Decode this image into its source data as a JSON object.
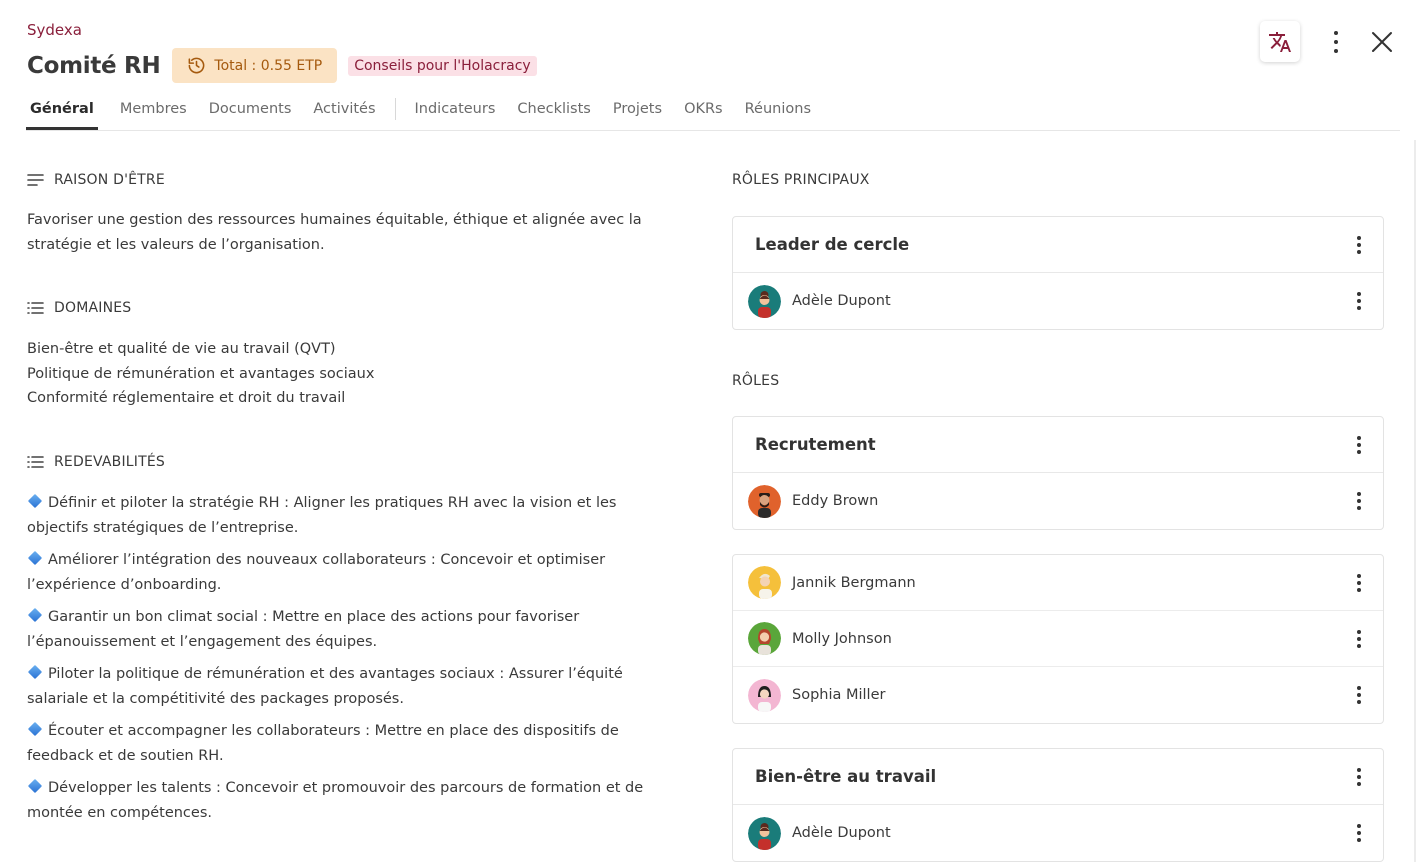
{
  "org_name": "Sydexa",
  "title": "Comité RH",
  "etp_badge": "Total : 0.55 ETP",
  "link_badge": "Conseils pour l'Holacracy",
  "colors": {
    "accent": "#8a1f3b",
    "etp_bg": "#fbe3c4",
    "etp_text": "#a55a0e",
    "link_bg": "#fbe0e6"
  },
  "icons": {
    "translate": "translate-icon",
    "more": "more-vert-icon",
    "close": "close-icon",
    "history": "history-icon"
  },
  "tabs": [
    {
      "label": "Général",
      "active": true
    },
    {
      "label": "Membres"
    },
    {
      "label": "Documents"
    },
    {
      "label": "Activités"
    },
    {
      "label": "Indicateurs"
    },
    {
      "label": "Checklists"
    },
    {
      "label": "Projets"
    },
    {
      "label": "OKRs"
    },
    {
      "label": "Réunions"
    }
  ],
  "purpose": {
    "heading": "RAISON D'ÊTRE",
    "text": "Favoriser une gestion des ressources humaines équitable, éthique et alignée avec la stratégie et les valeurs de l’organisation."
  },
  "domains": {
    "heading": "DOMAINES",
    "items": [
      "Bien-être et qualité de vie au travail (QVT)",
      "Politique de rémunération et avantages sociaux",
      "Conformité réglementaire et droit du travail"
    ]
  },
  "accountabilities": {
    "heading": "REDEVABILITÉS",
    "items": [
      "Définir et piloter la stratégie RH : Aligner les pratiques RH avec la vision et les objectifs stratégiques de l’entreprise.",
      "Améliorer l’intégration des nouveaux collaborateurs : Concevoir et optimiser l’expérience d’onboarding.",
      "Garantir un bon climat social : Mettre en place des actions pour favoriser l’épanouissement et l’engagement des équipes.",
      "Piloter la politique de rémunération et des avantages sociaux : Assurer l’équité salariale et la compétitivité des packages proposés.",
      "Écouter et accompagner les collaborateurs : Mettre en place des dispositifs de feedback et de soutien RH.",
      "Développer les talents : Concevoir et promouvoir des parcours de formation et de montée en compétences."
    ]
  },
  "main_roles": {
    "heading": "RÔLES PRINCIPAUX",
    "cards": [
      {
        "title": "Leader de cercle",
        "members": [
          "Adèle Dupont"
        ]
      }
    ]
  },
  "roles": {
    "heading": "RÔLES",
    "recruitment": {
      "title": "Recrutement",
      "members": [
        "Eddy Brown"
      ]
    },
    "unassigned_members": [
      "Jannik Bergmann",
      "Molly Johnson",
      "Sophia Miller"
    ],
    "wellbeing": {
      "title": "Bien-être au travail",
      "members": [
        "Adèle Dupont"
      ]
    }
  }
}
